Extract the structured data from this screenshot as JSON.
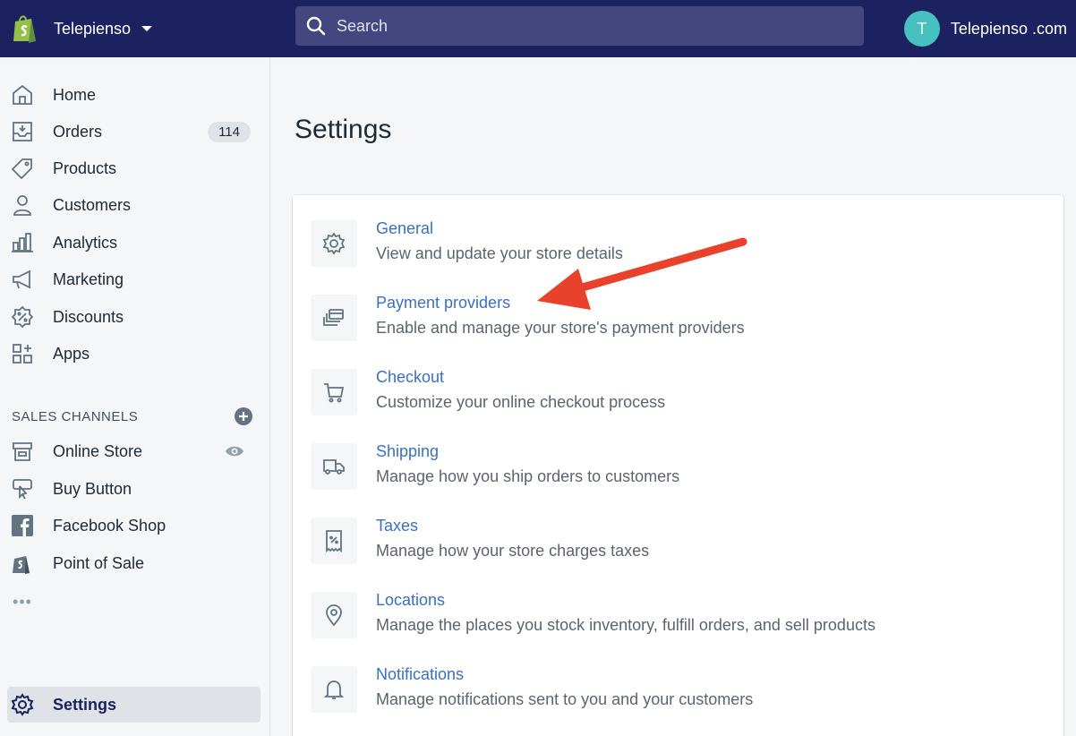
{
  "topbar": {
    "store_name": "Telepienso",
    "search_placeholder": "Search",
    "account_initial": "T",
    "account_name": "Telepienso .com"
  },
  "sidebar": {
    "items": [
      {
        "label": "Home",
        "icon": "home-icon"
      },
      {
        "label": "Orders",
        "icon": "orders-icon",
        "badge": "114"
      },
      {
        "label": "Products",
        "icon": "tag-icon"
      },
      {
        "label": "Customers",
        "icon": "person-icon"
      },
      {
        "label": "Analytics",
        "icon": "bar-chart-icon"
      },
      {
        "label": "Marketing",
        "icon": "megaphone-icon"
      },
      {
        "label": "Discounts",
        "icon": "discount-icon"
      },
      {
        "label": "Apps",
        "icon": "apps-icon"
      }
    ],
    "sales_channels_title": "SALES CHANNELS",
    "channels": [
      {
        "label": "Online Store",
        "icon": "store-icon"
      },
      {
        "label": "Buy Button",
        "icon": "buy-button-icon"
      },
      {
        "label": "Facebook Shop",
        "icon": "facebook-icon"
      },
      {
        "label": "Point of Sale",
        "icon": "pos-icon"
      }
    ],
    "more": "•••",
    "settings_label": "Settings"
  },
  "main": {
    "title": "Settings",
    "settings": [
      {
        "title": "General",
        "desc": "View and update your store details",
        "icon": "gear-icon"
      },
      {
        "title": "Payment providers",
        "desc": "Enable and manage your store's payment providers",
        "icon": "payment-icon"
      },
      {
        "title": "Checkout",
        "desc": "Customize your online checkout process",
        "icon": "cart-icon"
      },
      {
        "title": "Shipping",
        "desc": "Manage how you ship orders to customers",
        "icon": "truck-icon"
      },
      {
        "title": "Taxes",
        "desc": "Manage how your store charges taxes",
        "icon": "receipt-icon"
      },
      {
        "title": "Locations",
        "desc": "Manage the places you stock inventory, fulfill orders, and sell products",
        "icon": "location-pin-icon"
      },
      {
        "title": "Notifications",
        "desc": "Manage notifications sent to you and your customers",
        "icon": "bell-icon"
      }
    ]
  },
  "colors": {
    "topbar": "#1c2260",
    "link": "#3b6fc2",
    "arrow": "#e8412c",
    "avatar": "#47c1bf"
  }
}
